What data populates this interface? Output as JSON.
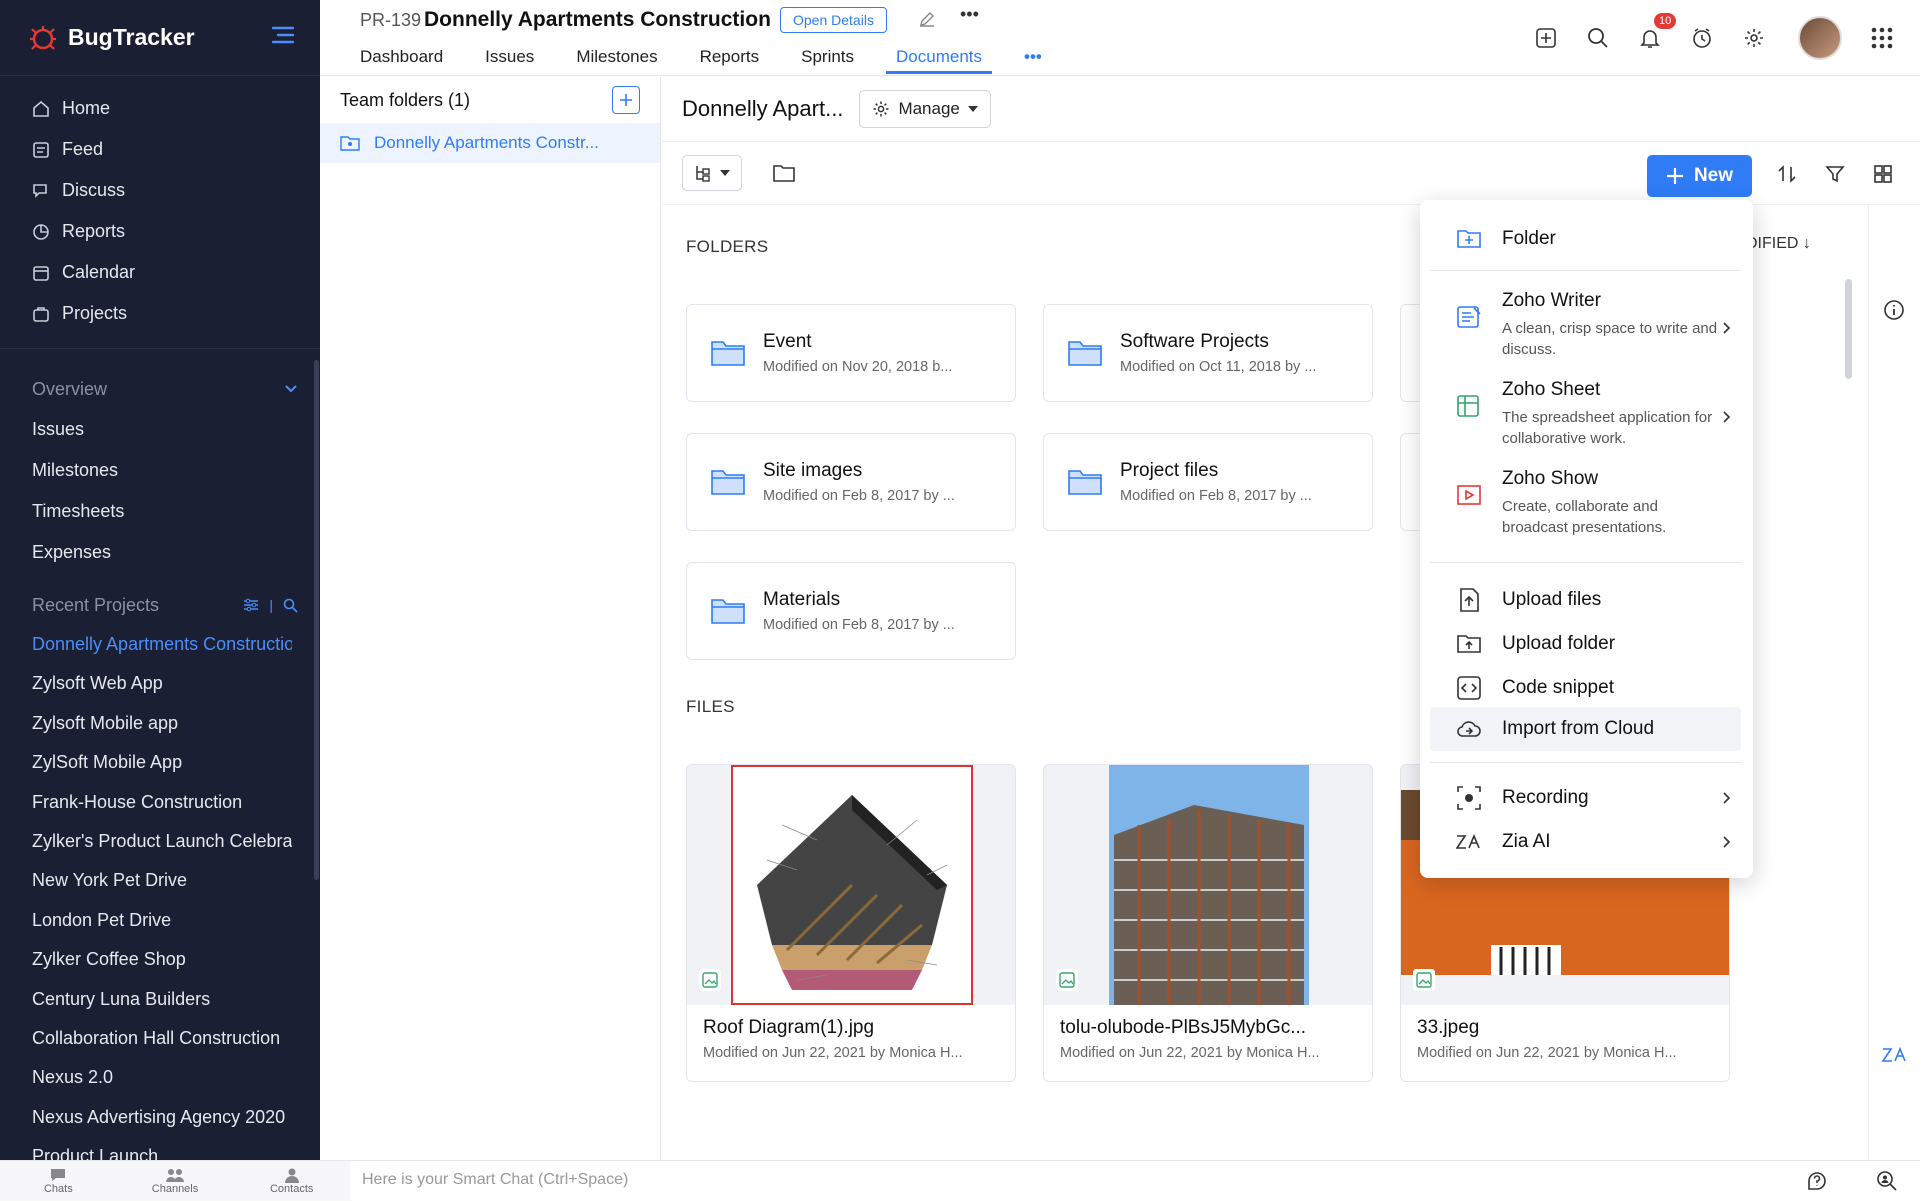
{
  "app": {
    "name": "BugTracker"
  },
  "sidebar": {
    "nav": [
      {
        "label": "Home",
        "icon": "home-icon"
      },
      {
        "label": "Feed",
        "icon": "feed-icon"
      },
      {
        "label": "Discuss",
        "icon": "discuss-icon"
      },
      {
        "label": "Reports",
        "icon": "reports-icon"
      },
      {
        "label": "Calendar",
        "icon": "calendar-icon"
      },
      {
        "label": "Projects",
        "icon": "projects-icon"
      }
    ],
    "overview_label": "Overview",
    "overview_items": [
      "Issues",
      "Milestones",
      "Timesheets",
      "Expenses"
    ],
    "recent_label": "Recent Projects",
    "recent_projects": [
      "Donnelly Apartments Construction",
      "Zylsoft Web App",
      "Zylsoft Mobile app",
      "ZylSoft Mobile App",
      "Frank-House Construction",
      "Zylker's Product Launch Celebration",
      "New York Pet Drive",
      "London Pet Drive",
      "Zylker Coffee Shop",
      "Century Luna Builders",
      "Collaboration Hall Construction",
      "Nexus 2.0",
      "Nexus Advertising Agency 2020",
      "Product Launch"
    ]
  },
  "header": {
    "project_id": "PR-139",
    "project_title": "Donnelly Apartments Construction",
    "open_details": "Open Details",
    "tabs": [
      "Dashboard",
      "Issues",
      "Milestones",
      "Reports",
      "Sprints",
      "Documents"
    ],
    "active_tab": "Documents",
    "more": "•••",
    "notification_count": "10"
  },
  "folder_panel": {
    "title": "Team folders (1)",
    "items": [
      "Donnelly Apartments Constr..."
    ]
  },
  "main": {
    "title": "Donnelly Apart...",
    "manage_label": "Manage",
    "new_label": "New",
    "folders_label": "FOLDERS",
    "files_label": "FILES",
    "sort_label": "DIFIED ↓",
    "folders": [
      {
        "name": "Event",
        "meta": "Modified on Nov 20, 2018 b..."
      },
      {
        "name": "Software Projects",
        "meta": "Modified on Oct 11, 2018 by ..."
      },
      {
        "name": "Site images",
        "meta": "Modified on Feb 8, 2017 by ..."
      },
      {
        "name": "Project files",
        "meta": "Modified on Feb 8, 2017 by ..."
      },
      {
        "name": "Materials",
        "meta": "Modified on Feb 8, 2017 by ..."
      }
    ],
    "files": [
      {
        "name": "Roof Diagram(1).jpg",
        "meta": "Modified on Jun 22, 2021 by Monica H..."
      },
      {
        "name": "tolu-olubode-PlBsJ5MybGc...",
        "meta": "Modified on Jun 22, 2021 by Monica H..."
      },
      {
        "name": "33.jpeg",
        "meta": "Modified on Jun 22, 2021 by Monica H..."
      }
    ]
  },
  "new_menu": {
    "folder": "Folder",
    "apps": [
      {
        "label": "Zoho Writer",
        "desc": "A clean, crisp space to write and discuss."
      },
      {
        "label": "Zoho Sheet",
        "desc": "The spreadsheet application for collaborative work."
      },
      {
        "label": "Zoho Show",
        "desc": "Create, collaborate and broadcast presentations."
      }
    ],
    "uploads": [
      "Upload files",
      "Upload folder",
      "Code snippet",
      "Import from Cloud"
    ],
    "extras": [
      "Recording",
      "Zia AI"
    ]
  },
  "bottom": {
    "tabs": [
      "Chats",
      "Channels",
      "Contacts"
    ],
    "smart_chat_placeholder": "Here is your Smart Chat (Ctrl+Space)"
  },
  "colors": {
    "accent": "#2f7cf6",
    "sidebar": "#1a1f33",
    "brand_red": "#e53935"
  }
}
